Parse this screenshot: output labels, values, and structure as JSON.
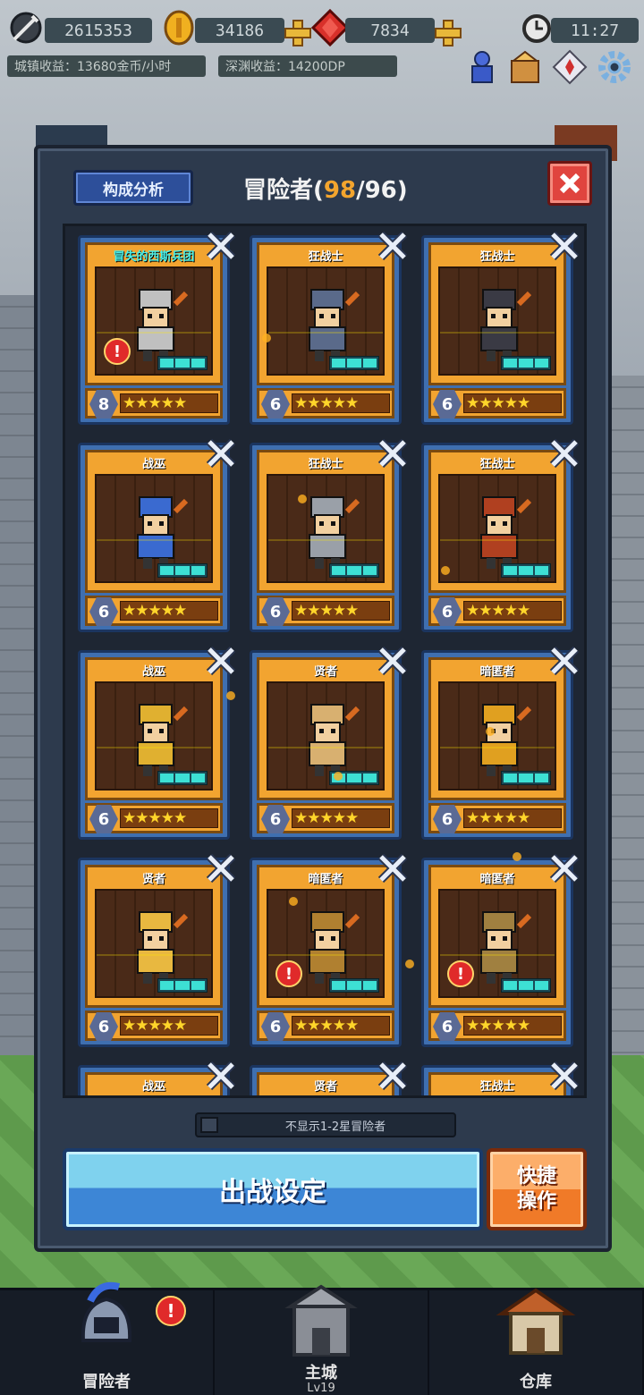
{
  "topbar": {
    "power": "2615353",
    "gold": "34186",
    "gems": "7834",
    "time": "11:27",
    "town_income": "城镇收益：13680金币/小时",
    "abyss_income": "深渊收益：14200DP"
  },
  "panel": {
    "analysis_button": "构成分析",
    "title_prefix": "冒险者(",
    "title_current": "98",
    "title_suffix": "/96)",
    "filter_label": "不显示1-2星冒险者",
    "battle_button": "出战设定",
    "quick_button": "快捷操作"
  },
  "cards": [
    {
      "name": "冒失的西斯兵团",
      "level": "8",
      "stars": "★★★★★",
      "special": true,
      "alert": true,
      "color": "#c0c0c0"
    },
    {
      "name": "狂战士",
      "level": "6",
      "stars": "★★★★★",
      "special": false,
      "alert": false,
      "color": "#5a6a8a"
    },
    {
      "name": "狂战士",
      "level": "6",
      "stars": "★★★★★",
      "special": false,
      "alert": false,
      "color": "#3a3a44"
    },
    {
      "name": "战巫",
      "level": "6",
      "stars": "★★★★★",
      "special": false,
      "alert": false,
      "color": "#3a6ad0"
    },
    {
      "name": "狂战士",
      "level": "6",
      "stars": "★★★★★",
      "special": false,
      "alert": false,
      "color": "#9aa0a8"
    },
    {
      "name": "狂战士",
      "level": "6",
      "stars": "★★★★★",
      "special": false,
      "alert": false,
      "color": "#b04020"
    },
    {
      "name": "战巫",
      "level": "6",
      "stars": "★★★★★",
      "special": false,
      "alert": false,
      "color": "#e0b030"
    },
    {
      "name": "贤者",
      "level": "6",
      "stars": "★★★★★",
      "special": false,
      "alert": false,
      "color": "#d8b070"
    },
    {
      "name": "暗匿者",
      "level": "6",
      "stars": "★★★★★",
      "special": false,
      "alert": false,
      "color": "#e0a020"
    },
    {
      "name": "贤者",
      "level": "6",
      "stars": "★★★★★",
      "special": false,
      "alert": false,
      "color": "#e8b840"
    },
    {
      "name": "暗匿者",
      "level": "6",
      "stars": "★★★★★",
      "special": false,
      "alert": true,
      "color": "#b08030"
    },
    {
      "name": "暗匿者",
      "level": "6",
      "stars": "★★★★★",
      "special": false,
      "alert": true,
      "color": "#a08040"
    },
    {
      "name": "战巫",
      "level": "",
      "stars": "",
      "special": false,
      "alert": false,
      "color": "#5a6a8a"
    },
    {
      "name": "贤者",
      "level": "",
      "stars": "",
      "special": false,
      "alert": false,
      "color": "#5a6a8a"
    },
    {
      "name": "狂战士",
      "level": "",
      "stars": "",
      "special": false,
      "alert": false,
      "color": "#5a6a8a"
    }
  ],
  "nav": [
    {
      "label": "冒险者",
      "sub": "",
      "alert": true
    },
    {
      "label": "主城",
      "sub": "Lv19",
      "alert": false
    },
    {
      "label": "仓库",
      "sub": "",
      "alert": false
    }
  ],
  "colors": {
    "accent_orange": "#f3a52e",
    "battle_blue": "#3d86d6",
    "quick_orange": "#f07a28",
    "close_red": "#e0443e"
  }
}
